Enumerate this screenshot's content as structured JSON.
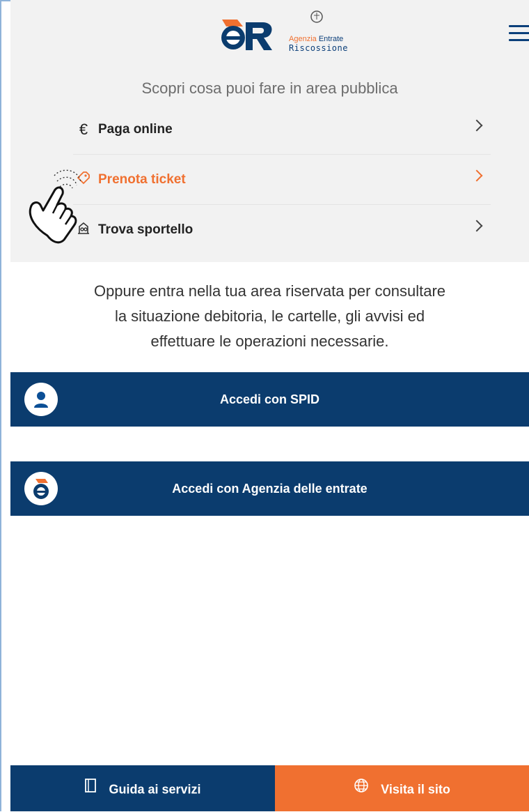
{
  "header": {
    "logo_text_line1_a": "Agenzia",
    "logo_text_line1_b": "Entrate",
    "logo_text_line2": "Riscossione",
    "menu_icon": "hamburger-icon"
  },
  "public_area": {
    "subtitle": "Scopri cosa puoi fare in area pubblica",
    "items": [
      {
        "label": "Paga online",
        "icon": "euro-icon",
        "active": false
      },
      {
        "label": "Prenota ticket",
        "icon": "ticket-icon",
        "active": true
      },
      {
        "label": "Trova sportello",
        "icon": "office-icon",
        "active": false
      }
    ]
  },
  "info_text": [
    "Oppure entra nella tua area riservata per consultare",
    "la situazione debitoria, le cartelle, gli avvisi ed",
    "effettuare le operazioni necessarie."
  ],
  "login": {
    "spid_label": "Accedi con SPID",
    "ade_label": "Accedi con Agenzia delle entrate"
  },
  "footer": {
    "guida_label": "Guida ai servizi",
    "visita_label": "Visita il sito"
  },
  "colors": {
    "navy": "#0b3c6e",
    "orange": "#f07030",
    "light_bg": "#f2f2f2"
  }
}
